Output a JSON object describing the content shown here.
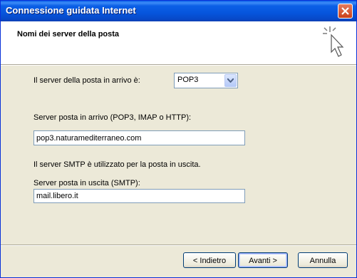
{
  "window": {
    "title": "Connessione guidata Internet"
  },
  "header": {
    "title": "Nomi dei server della posta",
    "icon": "wizard-cursor-icon"
  },
  "form": {
    "incoming_type_label": "Il server della posta in arrivo è:",
    "incoming_type_value": "POP3",
    "incoming_server_label": "Server posta in arrivo (POP3, IMAP o HTTP):",
    "incoming_server_value": "pop3.naturamediterraneo.com",
    "smtp_note": "Il server SMTP è utilizzato per la posta in uscita.",
    "outgoing_server_label": "Server posta in uscita (SMTP):",
    "outgoing_server_value": "mail.libero.it"
  },
  "buttons": {
    "back": "< Indietro",
    "next": "Avanti >",
    "cancel": "Annulla"
  },
  "colors": {
    "titlebar": "#0a5ee8",
    "dialog_bg": "#ece9d8",
    "close": "#c9401a"
  }
}
